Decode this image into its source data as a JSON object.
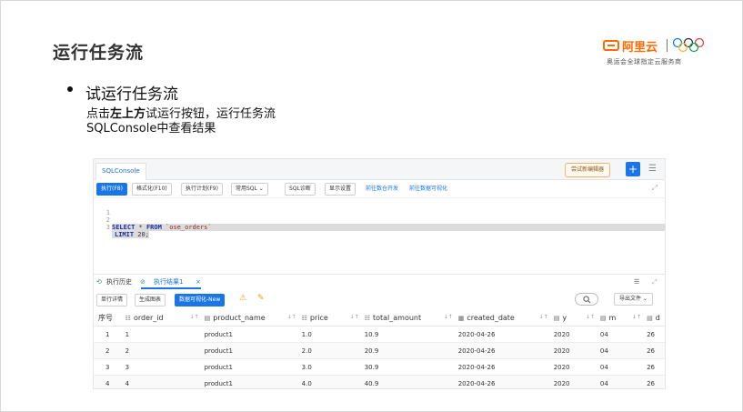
{
  "slide": {
    "title": "运行任务流",
    "bullet_heading": "试运行任务流",
    "line1_prefix": "点击",
    "line1_bold": "左上方",
    "line1_suffix": "试运行按钮，运行任务流",
    "line2": "SQLConsole中查看结果"
  },
  "logo": {
    "brand": "阿里云",
    "subtitle": "奥运会全球指定云服务商",
    "brand_color": "#ff6a00"
  },
  "console": {
    "tab": "SQLConsole",
    "try_editor": "尝试新编辑器",
    "plus": "+",
    "menu_icon": "☰",
    "toolbar": {
      "run": "执行(F8)",
      "format": "格式化(F10)",
      "plan": "执行计划(F9)",
      "common_sql": "常用SQL ⌄",
      "diagnose": "SQL诊断",
      "display": "显示设置",
      "link_dev": "前往数仓开发",
      "link_viz": "前往数据可视化"
    },
    "editor_lines": [
      {
        "num": "1"
      },
      {
        "num": "2",
        "kw1": "SELECT",
        "mid": " * ",
        "kw2": "FROM",
        "str": " `ose_orders`"
      },
      {
        "num": "3",
        "kw1": "LIMIT",
        "mid": " 20;"
      }
    ],
    "results": {
      "history": "执行历史",
      "result_tab": "执行结果1",
      "close": "×",
      "row_detail": "单行详情",
      "gen_chart": "生成图表",
      "viz_new": "数据可视化-New",
      "search_icon": "magnifier-icon",
      "export": "导出文件 ⌄"
    },
    "table": {
      "columns": [
        "序号",
        "order_id",
        "product_name",
        "price",
        "total_amount",
        "created_date",
        "y",
        "m",
        "d"
      ],
      "rows": [
        [
          "1",
          "1",
          "product1",
          "1.0",
          "10.9",
          "2020-04-26",
          "2020",
          "04",
          "26"
        ],
        [
          "2",
          "2",
          "product1",
          "2.0",
          "20.9",
          "2020-04-26",
          "2020",
          "04",
          "26"
        ],
        [
          "3",
          "3",
          "product1",
          "3.0",
          "30.9",
          "2020-04-26",
          "2020",
          "04",
          "26"
        ],
        [
          "4",
          "4",
          "product1",
          "4.0",
          "40.9",
          "2020-04-26",
          "2020",
          "04",
          "26"
        ]
      ]
    },
    "accent_color": "#1a76e8"
  }
}
